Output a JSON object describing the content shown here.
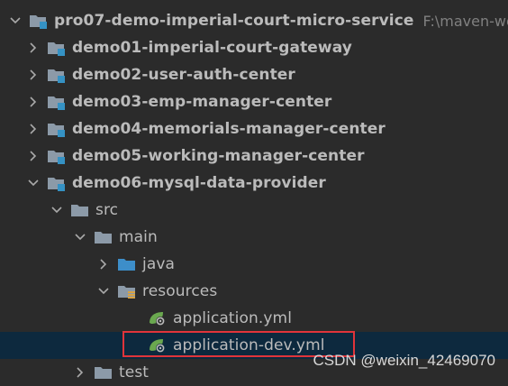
{
  "project": {
    "name": "pro07-demo-imperial-court-micro-service",
    "path": "F:\\maven-wor"
  },
  "modules": [
    {
      "label": "demo01-imperial-court-gateway"
    },
    {
      "label": "demo02-user-auth-center"
    },
    {
      "label": "demo03-emp-manager-center"
    },
    {
      "label": "demo04-memorials-manager-center"
    },
    {
      "label": "demo05-working-manager-center"
    },
    {
      "label": "demo06-mysql-data-provider"
    }
  ],
  "folders": {
    "src": "src",
    "main": "main",
    "java": "java",
    "resources": "resources",
    "test": "test"
  },
  "files": {
    "application_yml": "application.yml",
    "application_dev_yml": "application-dev.yml"
  },
  "watermark": "CSDN @weixin_42469070",
  "colors": {
    "background": "#2b2b2b",
    "selection": "#0d293e",
    "highlight_box": "#e0343a",
    "module_badge": "#3592c4",
    "spring_leaf": "#6aa84f"
  }
}
